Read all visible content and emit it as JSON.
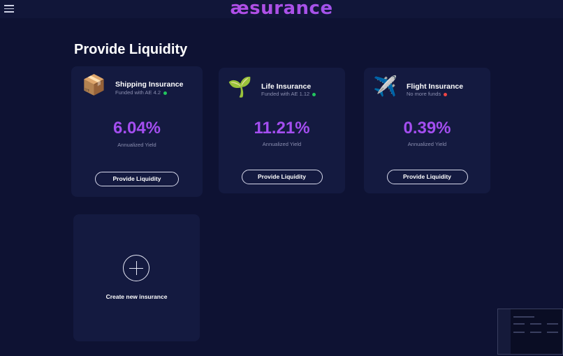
{
  "header": {
    "logo": "æsurance"
  },
  "page": {
    "title": "Provide Liquidity"
  },
  "cards": [
    {
      "icon": "package-icon",
      "icon_glyph": "📦",
      "title": "Shipping Insurance",
      "subtitle": "Funded with AE 4.2",
      "status_color": "#22c55e",
      "yield": "6.04%",
      "yield_label": "Annualized Yield",
      "button": "Provide Liquidity"
    },
    {
      "icon": "seedling-icon",
      "icon_glyph": "🌱",
      "title": "Life Insurance",
      "subtitle": "Funded with AE 1.12",
      "status_color": "#22c55e",
      "yield": "11.21%",
      "yield_label": "Annualized Yield",
      "button": "Provide Liquidity"
    },
    {
      "icon": "airplane-icon",
      "icon_glyph": "✈️",
      "title": "Flight Insurance",
      "subtitle": "No more funds",
      "status_color": "#ef4444",
      "yield": "0.39%",
      "yield_label": "Annualized Yield",
      "button": "Provide Liquidity"
    }
  ],
  "create_card": {
    "label": "Create new insurance"
  },
  "colors": {
    "background": "#0e1233",
    "card": "#141a40",
    "accent": "#a44ef0"
  }
}
